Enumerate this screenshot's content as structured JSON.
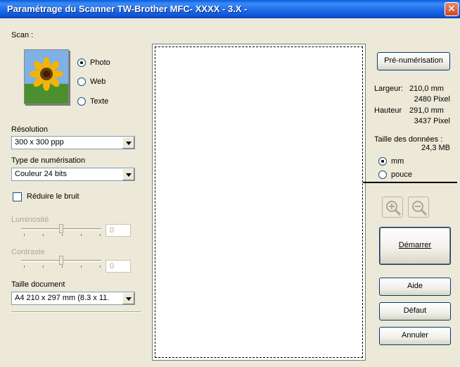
{
  "window": {
    "title": "Paramétrage du Scanner TW-Brother  MFC- XXXX - 3.X -",
    "close_glyph": "✕"
  },
  "scan": {
    "label": "Scan :",
    "options": [
      {
        "label": "Photo",
        "selected": true
      },
      {
        "label": "Web",
        "selected": false
      },
      {
        "label": "Texte",
        "selected": false
      }
    ],
    "thumbnail_icon": "sunflower-photo-icon"
  },
  "resolution": {
    "label": "Résolution",
    "value": "300 x 300 ppp"
  },
  "scan_type": {
    "label": "Type de numérisation",
    "value": "Couleur 24 bits"
  },
  "noise": {
    "label": "Réduire le bruit",
    "checked": false
  },
  "brightness": {
    "label": "Luminosité",
    "value": "0"
  },
  "contrast": {
    "label": "Contraste",
    "value": "0"
  },
  "doc_size": {
    "label": "Taille document",
    "value": "A4 210 x 297 mm (8.3 x 11."
  },
  "right_panel": {
    "prescan_label": "Pré-numérisation",
    "width_label": "Largeur:",
    "width_mm": "210,0 mm",
    "width_px": "2480 Pixel",
    "height_label": "Hauteur",
    "height_mm": "291,0 mm",
    "height_px": "3437 Pixel",
    "data_size_label": "Taille des données :",
    "data_size_value": "24,3 MB",
    "unit_options": [
      {
        "label": "mm",
        "selected": true
      },
      {
        "label": "pouce",
        "selected": false
      }
    ],
    "zoom_in_icon": "zoom-in-icon",
    "zoom_out_icon": "zoom-out-icon"
  },
  "buttons": {
    "start": "Démarrer",
    "help": "Aide",
    "default": "Défaut",
    "cancel": "Annuler"
  }
}
